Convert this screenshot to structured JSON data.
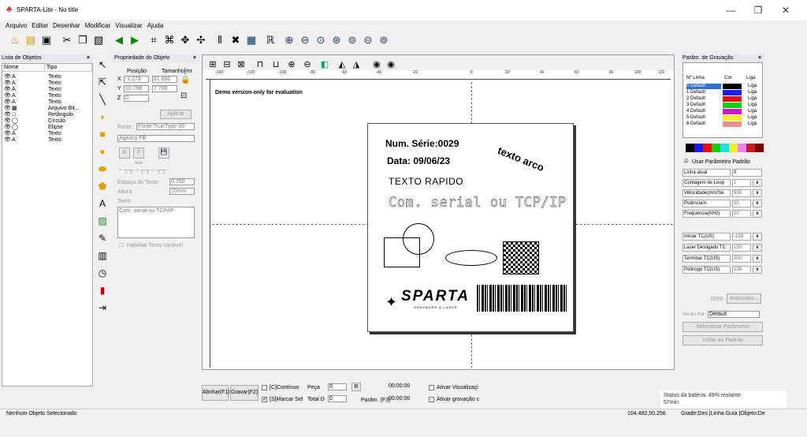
{
  "window": {
    "title": "SPARTA-Lite - No title",
    "min": "—",
    "max": "❐",
    "close": "✕"
  },
  "menu": [
    "Arquivo",
    "Editar",
    "Desenhar",
    "Modificar",
    "Visualizar",
    "Ajuda"
  ],
  "objects_panel": {
    "title": "Lista de Objetos",
    "close": "×",
    "col_name": "Nome",
    "col_type": "Tipo",
    "rows": [
      {
        "name": "A",
        "type": "Texto"
      },
      {
        "name": "A",
        "type": "Texto"
      },
      {
        "name": "A",
        "type": "Texto"
      },
      {
        "name": "A",
        "type": "Texto"
      },
      {
        "name": "A",
        "type": "Texto"
      },
      {
        "name": "▦",
        "type": "Arquivo Bit..."
      },
      {
        "name": "□",
        "type": "Retângulo"
      },
      {
        "name": "◯",
        "type": "Círculo"
      },
      {
        "name": "◯",
        "type": "Elipse"
      },
      {
        "name": "A",
        "type": "Texto"
      },
      {
        "name": "A",
        "type": "Texto"
      }
    ]
  },
  "props": {
    "title": "Propriedade do Objeto",
    "close": "×",
    "pos": "Posição",
    "size": "Tamanho[mr",
    "x_label": "X",
    "x": "-1.278",
    "w": "81.880",
    "y_label": "Y",
    "y": "10.796",
    "h": "7.700",
    "z_label": "Z",
    "z": "0",
    "apply": "Aplicar",
    "font_label": "Fonte",
    "font_type": "Fonte TrueType-30",
    "font_name": "Agency FB",
    "bold": "B",
    "italic": "F",
    "save": "💾",
    "auto": "Auto",
    "spacing_label": "Espaço do Texto",
    "spacing": "0.760",
    "height_label": "Altura",
    "height": "10mm",
    "text_label": "Texto",
    "text": "Com. serial ou TCP/IP",
    "var_text": "Habilitar Texto Variável"
  },
  "canvas": {
    "demo": "Demo version-only for evaluation",
    "ruler_ticks": [
      "-160",
      "-120",
      "-100",
      "-80",
      "-60",
      "-40",
      "-20",
      "0",
      "20",
      "40",
      "60",
      "80",
      "100",
      "120"
    ],
    "serial": "Num. Série:0029",
    "date": "Data: 09/06/23",
    "arc": "texto arco",
    "quick": "TEXTO RAPIDO",
    "com": "Com. serial ou TCP/IP",
    "logo": "SPARTA",
    "logo_sub": "GRAVAÇÃO A LASER"
  },
  "bottom": {
    "align": "Alinhar(F1)",
    "engrave": "Gravar(F2)",
    "continuous": "[C]Contínuo",
    "piece_label": "Peça",
    "piece": "0",
    "r": "R",
    "time1": "00:00:00",
    "preview": "Ativar Visualizaçi",
    "mark_sel": "[S]Marcar Sel",
    "total_label": "Total D",
    "total": "0",
    "params": "Parâm. (F3)",
    "time2": "00:00:00",
    "activate": "Ativar gravação c"
  },
  "engrave_panel": {
    "title": "Parâm. de Gravação",
    "close": "×",
    "col_line": "Nº Linha",
    "col_color": "Cor",
    "col_on": "Liga",
    "lines": [
      {
        "label": "0 Default",
        "color": "#000000",
        "on": "Liga"
      },
      {
        "label": "1 Default",
        "color": "#1a1aff",
        "on": "Liga"
      },
      {
        "label": "2 Default",
        "color": "#e01010",
        "on": "Liga"
      },
      {
        "label": "3 Default",
        "color": "#10d010",
        "on": "Liga"
      },
      {
        "label": "4 Default",
        "color": "#d010d0",
        "on": "Liga"
      },
      {
        "label": "5 Default",
        "color": "#f0f020",
        "on": "Liga"
      },
      {
        "label": "6 Default",
        "color": "#e89090",
        "on": "Liga"
      }
    ],
    "swatches": [
      "#000000",
      "#1a1aff",
      "#e01010",
      "#10d010",
      "#20e0e0",
      "#f0f020",
      "#f080f0",
      "#c02020",
      "#800000"
    ],
    "use_default": "Usar Parâmetro Padrão",
    "params": [
      {
        "label": "Linha atual",
        "value": "0"
      },
      {
        "label": "Contagem de Loop",
        "value": "1"
      },
      {
        "label": "Velocidade(mm/Se",
        "value": "500"
      },
      {
        "label": "Potência%",
        "value": "50"
      },
      {
        "label": "Frequencia(KHz)",
        "value": "20"
      }
    ],
    "timing": [
      {
        "label": "Iniciar TC(US)",
        "value": "-150"
      },
      {
        "label": "Laser Desligado TC",
        "value": "150"
      },
      {
        "label": "Terminar TC(US)",
        "value": "300"
      },
      {
        "label": "Polinogo TC(US)",
        "value": "100"
      }
    ],
    "advanced": "Avançado...",
    "code": "0000",
    "param_name_label": "me do Par",
    "param_name": "Default",
    "select_param": "Selecionar Parâmetro",
    "back_default": "Voltar ao Padrão"
  },
  "status": {
    "left": "Nenhum Objeto Selecionado",
    "coords": "104.492,50.256",
    "right": "Grade:Des |Linha Guia |Objeto:De"
  },
  "toast": {
    "text": "Status da bateria: 49% restante",
    "sub": "57min"
  }
}
